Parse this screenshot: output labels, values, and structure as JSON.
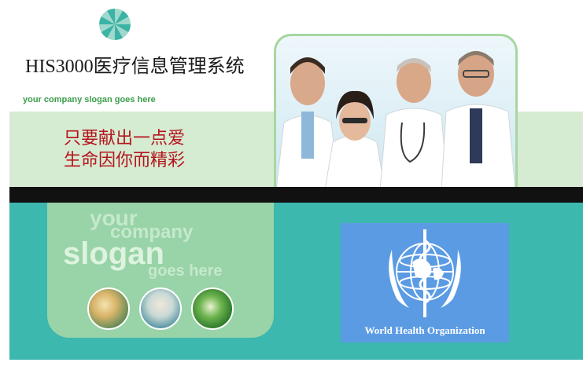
{
  "header": {
    "app_title": "HIS3000医疗信息管理系统",
    "slogan_small": "your company slogan goes here",
    "logo_icon": "pinwheel-icon"
  },
  "motto": {
    "line1": "只要献出一点爱",
    "line2": "生命因你而精彩"
  },
  "slogan_big": {
    "your": "your",
    "company": "company",
    "slogan": "slogan",
    "goes_here": "goes here"
  },
  "who": {
    "label": "World Health Organization"
  },
  "colors": {
    "accent_teal": "#3db8ae",
    "band_green": "#d6ecd2",
    "panel_green": "#99d3a8",
    "motto_red": "#b5141e",
    "who_blue": "#5b9be3"
  }
}
